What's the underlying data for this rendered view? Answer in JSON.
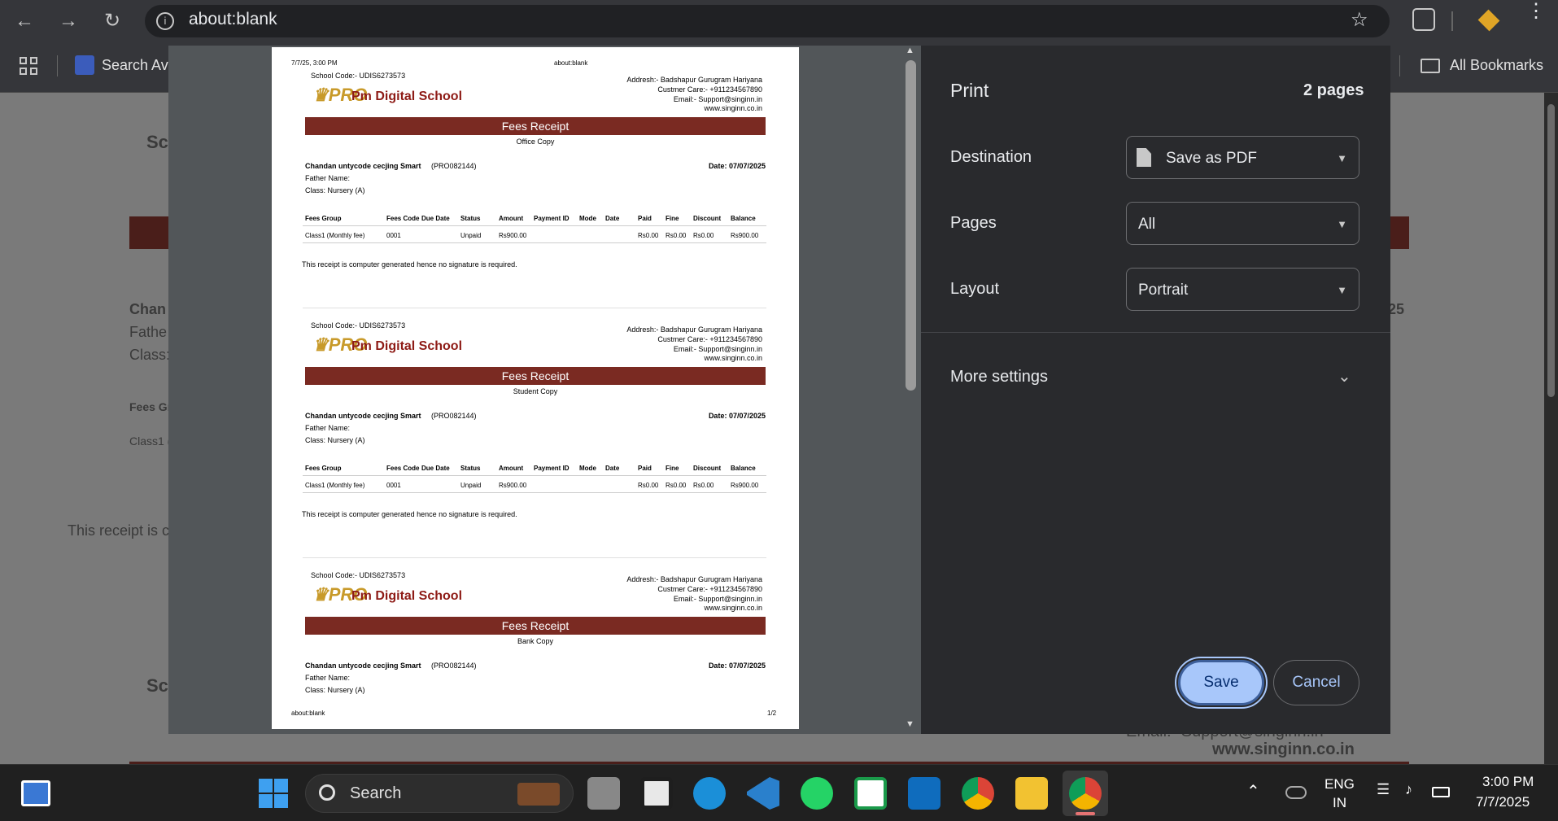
{
  "browser": {
    "url": "about:blank",
    "bookmarks": [
      "Search Ava",
      "All Bookmarks"
    ]
  },
  "backdrop": {
    "fragments": [
      "Sc",
      "Chan",
      "Fathe",
      "Class:",
      "Fees Gr",
      "Class1 (",
      "This receipt is c",
      "Sc",
      "25",
      "Email:- Support@singinn.in",
      "www.singinn.co.in"
    ]
  },
  "preview": {
    "header_left": "7/7/25, 3:00 PM",
    "header_center": "about:blank",
    "footer_left": "about:blank",
    "footer_right": "1/2",
    "receipts": [
      {
        "copy": "Office Copy"
      },
      {
        "copy": "Student Copy"
      },
      {
        "copy": "Bank Copy"
      }
    ],
    "school_code": "School Code:- UDIS6273573",
    "school_name": "Pm Digital School",
    "logo_text": "PRO",
    "address": "Addresh:- Badshapur Gurugram Hariyana",
    "care": "Custmer Care:- +911234567890",
    "email": "Email:- Support@singinn.in",
    "website": "www.singinn.co.in",
    "title": "Fees Receipt",
    "student_name": "Chandan untycode cecjing Smart",
    "student_id": "(PRO082144)",
    "date": "Date: 07/07/2025",
    "father": "Father Name:",
    "class": "Class: Nursery (A)",
    "table_headers": [
      "Fees Group",
      "Fees Code",
      "Due Date",
      "Status",
      "Amount",
      "Payment ID",
      "Mode",
      "Date",
      "Paid",
      "Fine",
      "Discount",
      "Balance"
    ],
    "table_row": [
      "Class1 (Monthly fee)",
      "0001",
      "",
      "Unpaid",
      "Rs900.00",
      "",
      "",
      "",
      "Rs0.00",
      "Rs0.00",
      "Rs0.00",
      "Rs900.00"
    ],
    "note": "This receipt is computer generated hence no signature is required."
  },
  "print": {
    "title": "Print",
    "page_count": "2 pages",
    "destination_label": "Destination",
    "destination_value": "Save as PDF",
    "pages_label": "Pages",
    "pages_value": "All",
    "layout_label": "Layout",
    "layout_value": "Portrait",
    "more_settings": "More settings",
    "save": "Save",
    "cancel": "Cancel"
  },
  "taskbar": {
    "search": "Search",
    "lang1": "ENG",
    "lang2": "IN",
    "time": "3:00 PM",
    "date": "7/7/2025"
  }
}
